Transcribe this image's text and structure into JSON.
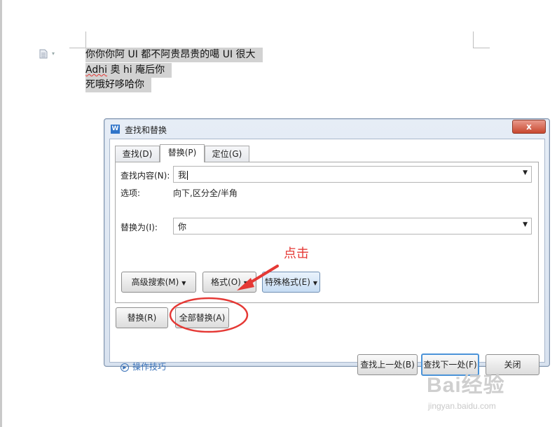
{
  "document": {
    "lines": [
      "你你你阿 UI 都不阿贵昂贵的噶 UI 很大",
      "奥 hi 庵后你",
      "死哦好哆哈你"
    ],
    "line2_prefix": "Adhi"
  },
  "dialog": {
    "title": "查找和替换",
    "close_label": "x",
    "tabs": [
      {
        "label": "查找(D)",
        "active": false
      },
      {
        "label": "替换(P)",
        "active": true
      },
      {
        "label": "定位(G)",
        "active": false
      }
    ],
    "find_label": "查找内容(N):",
    "find_value": "我",
    "options_label": "选项:",
    "options_value": "向下,区分全/半角",
    "replace_label": "替换为(I):",
    "replace_value": "你",
    "advanced_search_label": "高级搜索(M)",
    "format_label": "格式(O)",
    "special_format_label": "特殊格式(E)",
    "replace_button": "替换(R)",
    "replace_all_button": "全部替换(A)",
    "tips_label": "操作技巧",
    "find_prev_button": "查找上一处(B)",
    "find_next_button": "查找下一处(F)",
    "close_button": "关闭"
  },
  "annotation": {
    "text": "点击",
    "color": "#e53935"
  },
  "watermark": {
    "main": "Bai经验",
    "sub": "jingyan.baidu.com"
  },
  "colors": {
    "accent_blue": "#4b93d8",
    "selection_gray": "#d2d2d2"
  }
}
